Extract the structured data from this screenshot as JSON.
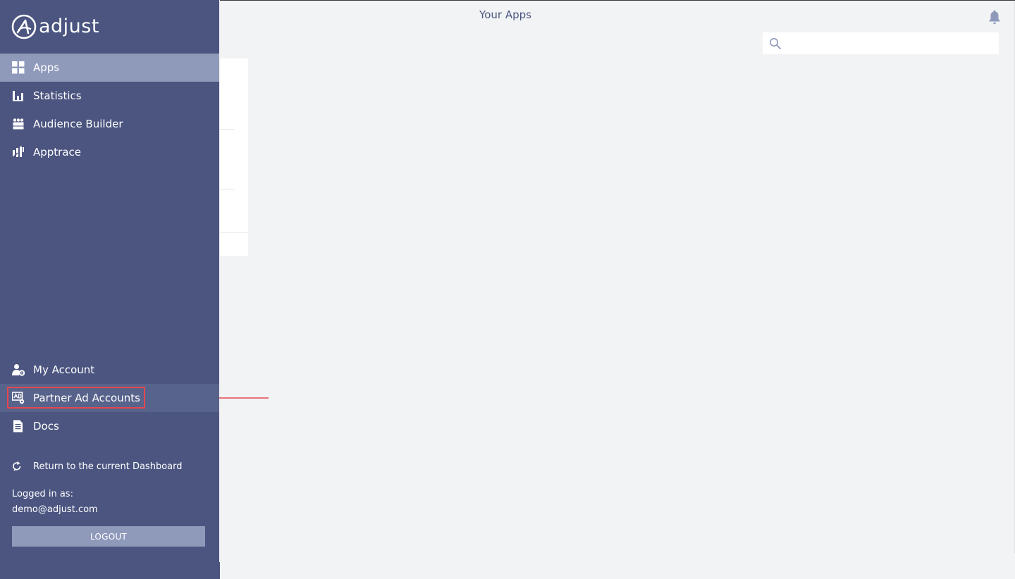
{
  "header": {
    "title": "Your Apps",
    "bell_icon": "bell-icon"
  },
  "search": {
    "placeholder": "",
    "value": "",
    "icon": "search-icon"
  },
  "brand": {
    "logo_text": "adjust",
    "logo_icon": "adjust-logo-icon"
  },
  "sidebar": {
    "items": [
      {
        "label": "Apps",
        "icon": "grid-icon",
        "state": "active"
      },
      {
        "label": "Statistics",
        "icon": "bar-chart-icon"
      },
      {
        "label": "Audience Builder",
        "icon": "audience-icon"
      },
      {
        "label": "Apptrace",
        "icon": "apptrace-icon"
      }
    ],
    "bottom_items": [
      {
        "label": "My Account",
        "icon": "user-gear-icon"
      },
      {
        "label": "Partner Ad Accounts",
        "icon": "ad-accounts-icon",
        "state": "highlighted"
      },
      {
        "label": "Docs",
        "icon": "document-icon"
      }
    ],
    "return_link": {
      "label": "Return to the current Dashboard",
      "icon": "refresh-icon"
    },
    "logged_in_label": "Logged in as:",
    "logged_in_email": "demo@adjust.com",
    "logout_label": "LOGOUT"
  },
  "colors": {
    "sidebar_bg": "#4b5580",
    "active_item_bg": "#8f9abb",
    "highlight_border": "#e5474f",
    "page_bg": "#f2f3f5",
    "arrow": "#e5474f"
  }
}
